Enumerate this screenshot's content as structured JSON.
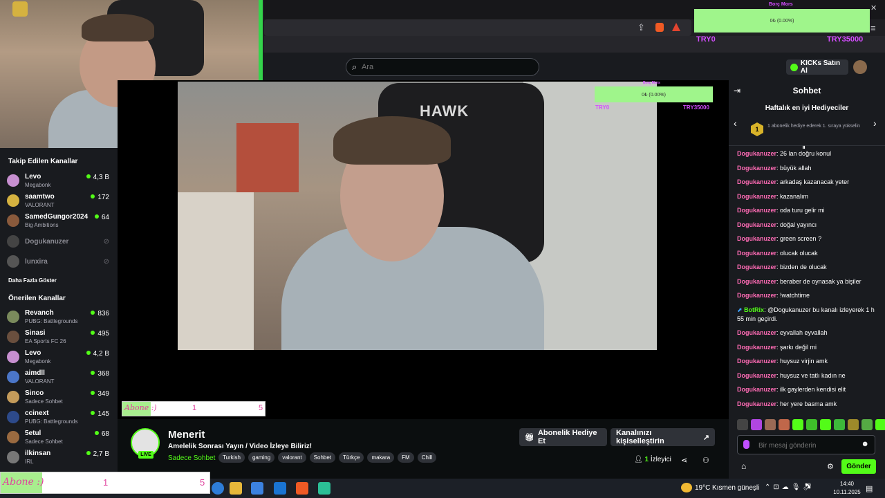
{
  "search": {
    "placeholder": "Ara"
  },
  "header": {
    "buy_kicks": "KICKs Satın Al"
  },
  "overlays": {
    "top_goal_title": "Borç Mors",
    "top_goal_value": "0₺ (0.00%)",
    "top_goal_left": "TRY0",
    "top_goal_right": "TRY35000",
    "video_goal_title": "Borç Mors",
    "video_goal_value": "0₺ (0.00%)",
    "video_goal_left": "TRY0",
    "video_goal_right": "TRY35000",
    "sub_goal_text": "Abone :)",
    "sub_goal_current": "1",
    "sub_goal_target": "5",
    "sub_goal_progress": 0.2,
    "video_brand": "HAWK"
  },
  "sidebar": {
    "followed_title": "Takip Edilen Kanallar",
    "followed": [
      {
        "name": "Levo",
        "category": "Megabonk",
        "viewers": "4,3 B",
        "color": "#c78fd0"
      },
      {
        "name": "saamtwo",
        "category": "VALORANT",
        "viewers": "172",
        "color": "#d5b240"
      },
      {
        "name": "SamedGungor2024",
        "category": "Big Ambitions",
        "viewers": "64",
        "color": "#8a5a3c"
      }
    ],
    "offline": [
      {
        "name": "Dogukanuzer",
        "color": "#555"
      },
      {
        "name": "lunxira",
        "color": "#666"
      }
    ],
    "show_more": "Daha Fazla Göster",
    "recommended_title": "Önerilen Kanallar",
    "recommended": [
      {
        "name": "Revanch",
        "category": "PUBG: Battlegrounds",
        "viewers": "836",
        "color": "#7a8a5c"
      },
      {
        "name": "Sinasi",
        "category": "EA Sports FC 26",
        "viewers": "495",
        "color": "#6a4f3e"
      },
      {
        "name": "Levo",
        "category": "Megabonk",
        "viewers": "4,2 B",
        "color": "#c78fd0"
      },
      {
        "name": "aimdll",
        "category": "VALORANT",
        "viewers": "368",
        "color": "#4b76c8"
      },
      {
        "name": "Sinco",
        "category": "Sadece Sohbet",
        "viewers": "349",
        "color": "#c49b5a"
      },
      {
        "name": "ccinext",
        "category": "PUBG: Battlegrounds",
        "viewers": "145",
        "color": "#2d4a8a"
      },
      {
        "name": "5etul",
        "category": "Sadece Sohbet",
        "viewers": "68",
        "color": "#9a6a40"
      },
      {
        "name": "ilkinsan",
        "category": "IRL",
        "viewers": "2,7 B",
        "color": "#777"
      }
    ]
  },
  "stream": {
    "streamer": "Menerit",
    "live": "LIVE",
    "title": "Amelelik Sonrası Yayın / Video İzleye Biliriz!",
    "category": "Sadece Sohbet",
    "tags": [
      "Turkish",
      "gaming",
      "valorant",
      "Sohbet",
      "Türkçe",
      "makara",
      "FM",
      "Chill"
    ],
    "gift_sub": "Abonelik Hediye Et",
    "customize": "Kanalınızı kişiselleştirin",
    "viewer_count": "1",
    "viewer_label": "İzleyici"
  },
  "chat": {
    "title": "Sohbet",
    "gifters_title": "Haftalık en iyi Hediyeciler",
    "gifter_rank": "1",
    "gifter_text": "1 abonelik hediye ederek 1. sıraya yükselin",
    "messages": [
      {
        "user": "Dogukanuzer",
        "text": "26 lan doğru konul"
      },
      {
        "user": "Dogukanuzer",
        "text": "büyük allah"
      },
      {
        "user": "Dogukanuzer",
        "text": "arkadaş kazanacak yeter"
      },
      {
        "user": "Dogukanuzer",
        "text": "kazanalım"
      },
      {
        "user": "Dogukanuzer",
        "text": "oda turu gelir mi"
      },
      {
        "user": "Dogukanuzer",
        "text": "doğal yayıncı"
      },
      {
        "user": "Dogukanuzer",
        "text": "green screen ?"
      },
      {
        "user": "Dogukanuzer",
        "text": "olucak olucak"
      },
      {
        "user": "Dogukanuzer",
        "text": "bizden de olucak"
      },
      {
        "user": "Dogukanuzer",
        "text": "beraber de oynasak ya bişiler"
      },
      {
        "user": "Dogukanuzer",
        "text": "!watchtime"
      }
    ],
    "bot_message": {
      "user": "BotRix",
      "text": "@Dogukanuzer bu kanalı izleyerek 1 h 55 min geçirdi."
    },
    "messages_after": [
      {
        "user": "Dogukanuzer",
        "text": "eyvallah eyvallah"
      },
      {
        "user": "Dogukanuzer",
        "text": "şarkı değil mi"
      },
      {
        "user": "Dogukanuzer",
        "text": "huysuz virjin amk"
      },
      {
        "user": "Dogukanuzer",
        "text": "huysuz ve tatlı kadın ne"
      },
      {
        "user": "Dogukanuzer",
        "text": "ilk gaylerden kendisi elit"
      },
      {
        "user": "Dogukanuzer",
        "text": "her yere basma amk"
      }
    ],
    "input_placeholder": "Bir mesaj gönderin",
    "send": "Gönder"
  },
  "taskbar": {
    "weather_temp": "19°C",
    "weather_desc": "Kısmen güneşli",
    "time": "14:40",
    "date": "10.11.2025"
  },
  "colors": {
    "accent": "#53fc18",
    "username": "#ff6bb5",
    "background": "#0b0e0f",
    "panel": "#191b1f"
  }
}
